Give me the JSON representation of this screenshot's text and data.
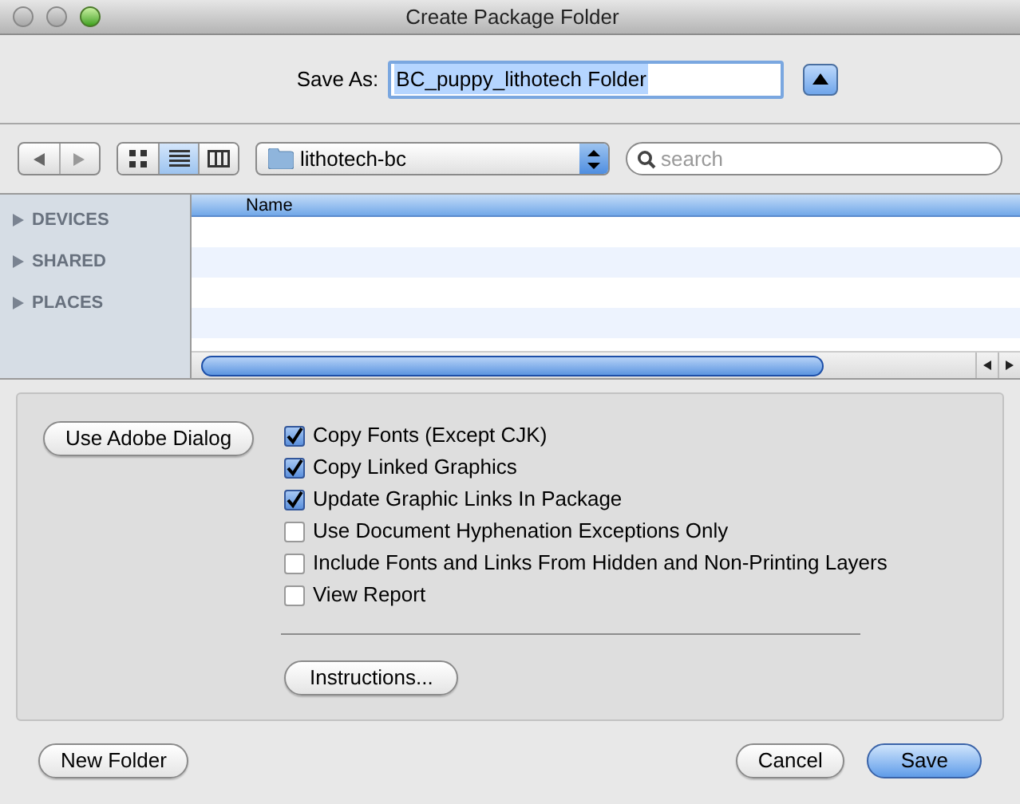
{
  "window": {
    "title": "Create Package Folder"
  },
  "save_as": {
    "label": "Save As:",
    "value": "BC_puppy_lithotech Folder",
    "expanded": true
  },
  "view_modes": [
    {
      "kind": "icons",
      "selected": false
    },
    {
      "kind": "list",
      "selected": true
    },
    {
      "kind": "columns",
      "selected": false
    }
  ],
  "location": {
    "value": "lithotech-bc"
  },
  "search": {
    "placeholder": "search"
  },
  "sidebar": {
    "sections": [
      {
        "label": "DEVICES",
        "expanded": false
      },
      {
        "label": "SHARED",
        "expanded": false
      },
      {
        "label": "PLACES",
        "expanded": false
      }
    ]
  },
  "table": {
    "columns": [
      "Name"
    ]
  },
  "options": {
    "dialog_button": "Use Adobe Dialog",
    "checkboxes": [
      {
        "label": "Copy Fonts (Except CJK)",
        "checked": true
      },
      {
        "label": "Copy Linked Graphics",
        "checked": true
      },
      {
        "label": "Update Graphic Links In Package",
        "checked": true
      },
      {
        "label": "Use Document Hyphenation Exceptions Only",
        "checked": false
      },
      {
        "label": "Include Fonts and Links From Hidden and Non-Printing Layers",
        "checked": false
      },
      {
        "label": "View Report",
        "checked": false
      }
    ],
    "instructions_button": "Instructions..."
  },
  "buttons": {
    "new_folder": "New Folder",
    "cancel": "Cancel",
    "save": "Save"
  }
}
